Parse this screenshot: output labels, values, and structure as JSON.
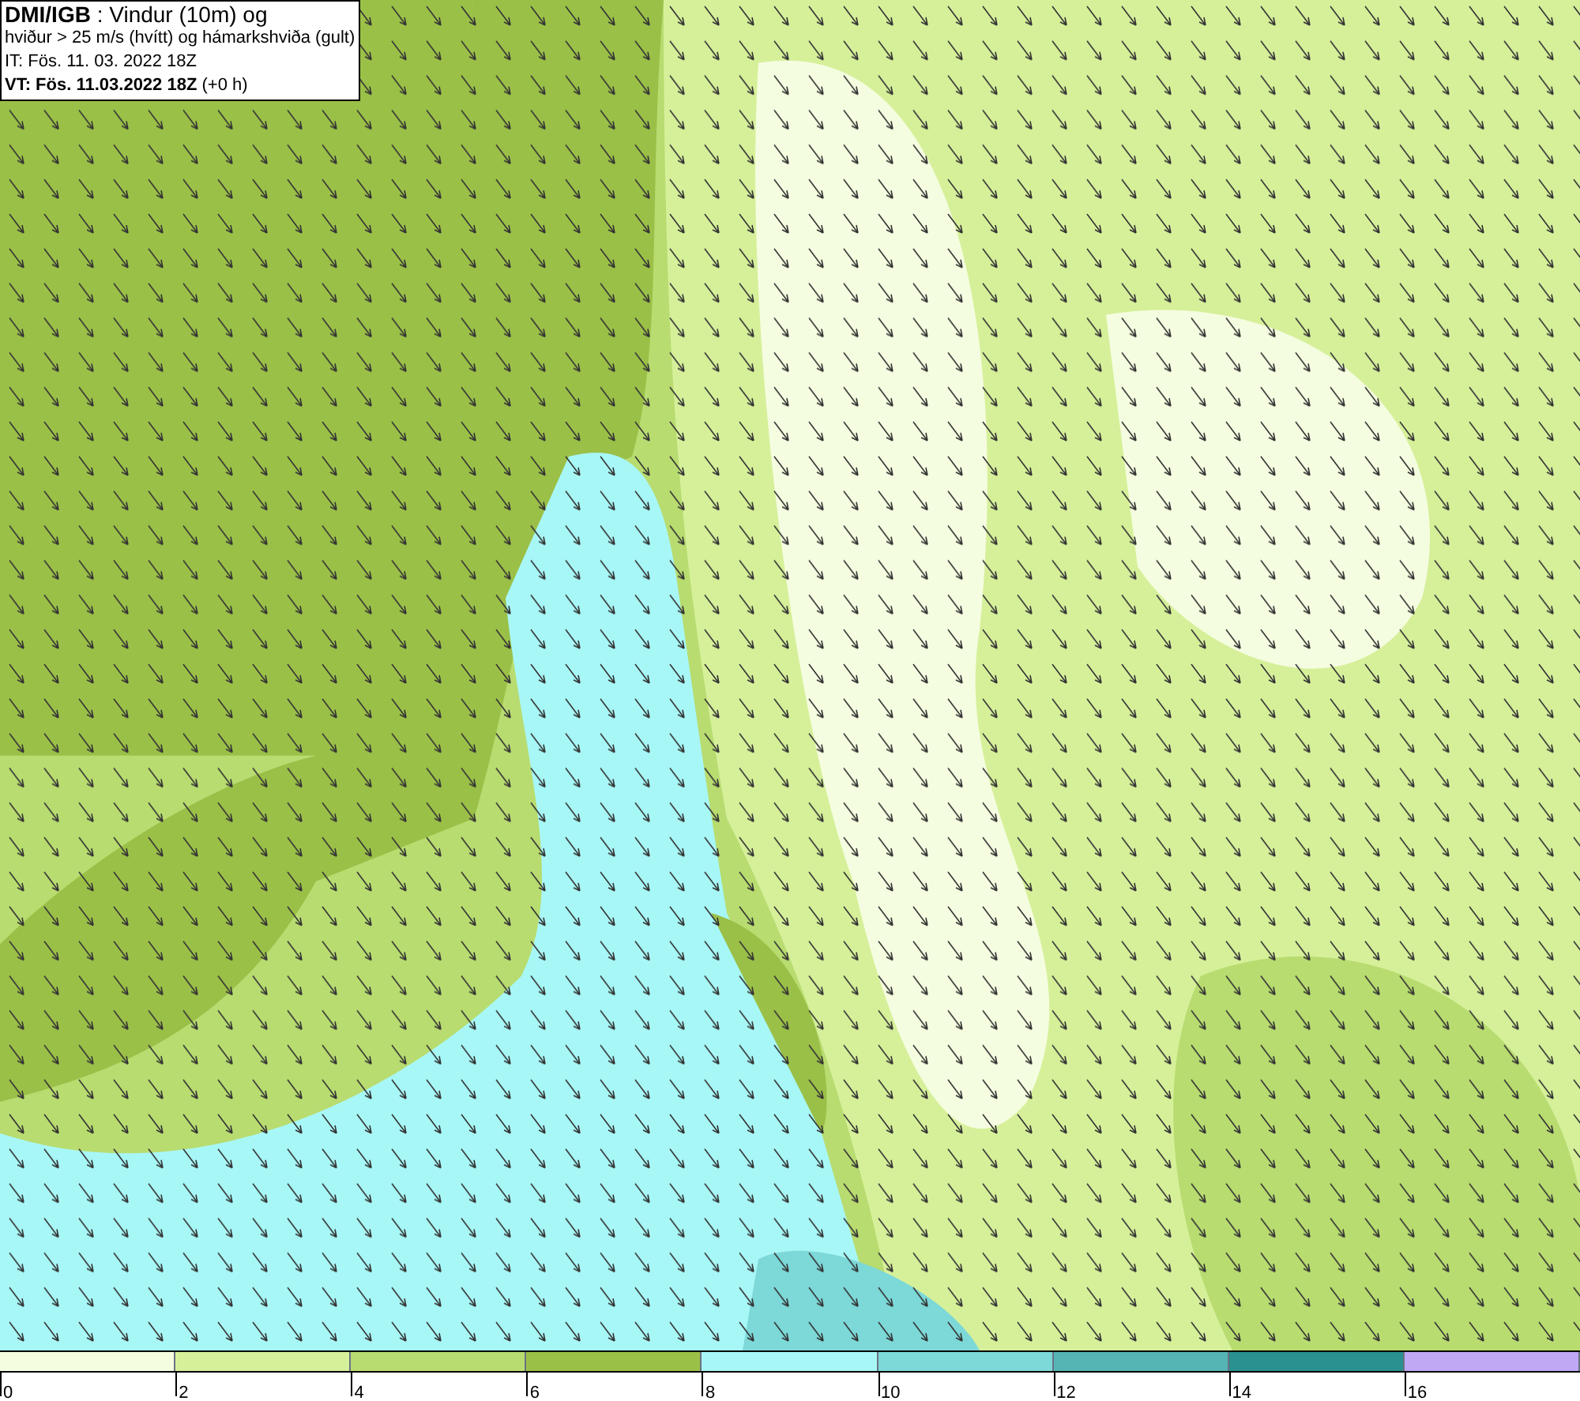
{
  "info_box": {
    "lines": [
      "**DMI/IGB** : Vindur (10m) og",
      "hviður > 25 m/s (hvítt) og hámarkshviða (gult)",
      "IT: Fös. 11. 03. 2022 18Z",
      "**VT: Fös. 11.03.2022 18Z** (+0 h)"
    ]
  },
  "legend": {
    "bins": [
      {
        "label": "0",
        "color": "#f5fde0"
      },
      {
        "label": "2",
        "color": "#d6f09a"
      },
      {
        "label": "4",
        "color": "#b8dc70"
      },
      {
        "label": "6",
        "color": "#9bc048"
      },
      {
        "label": "8",
        "color": "#a8f7f7"
      },
      {
        "label": "10",
        "color": "#7dd8d8"
      },
      {
        "label": "12",
        "color": "#55b5b5"
      },
      {
        "label": "14",
        "color": "#2a9090"
      },
      {
        "label": "16",
        "color": "#c0a8f5"
      }
    ]
  }
}
